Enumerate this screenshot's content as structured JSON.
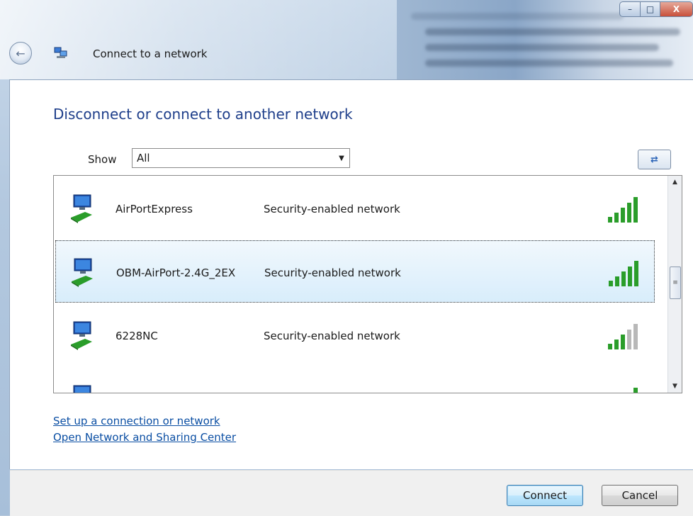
{
  "window": {
    "title": "Connect to a network",
    "controls": {
      "minimize": "–",
      "maximize": "□",
      "close": "X"
    }
  },
  "heading": "Disconnect or connect to another network",
  "filter": {
    "label": "Show",
    "selected": "All"
  },
  "networks": [
    {
      "name": "AirPortExpress",
      "security": "Security-enabled network",
      "signal_bars": 5,
      "selected": false
    },
    {
      "name": "OBM-AirPort-2.4G_2EX",
      "security": "Security-enabled network",
      "signal_bars": 5,
      "selected": true
    },
    {
      "name": "6228NC",
      "security": "Security-enabled network",
      "signal_bars": 3,
      "selected": false
    }
  ],
  "links": {
    "setup": "Set up a connection or network",
    "sharing_center": "Open Network and Sharing Center"
  },
  "buttons": {
    "connect": "Connect",
    "cancel": "Cancel"
  },
  "colors": {
    "heading": "#1e3e8a",
    "link": "#0a4ea3",
    "signal_on": "#2a9d2a",
    "signal_off": "#b8b8b8",
    "selection": "#d8edfb"
  }
}
